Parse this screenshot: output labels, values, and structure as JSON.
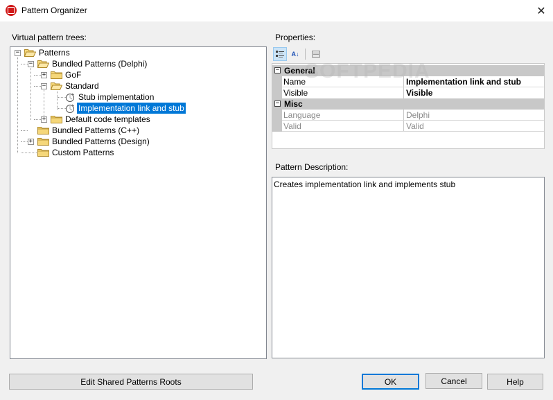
{
  "window": {
    "title": "Pattern Organizer",
    "close_glyph": "✕"
  },
  "left": {
    "label": "Virtual pattern trees:",
    "tree": {
      "root": "Patterns",
      "delphi": "Bundled Patterns (Delphi)",
      "gof": "GoF",
      "standard": "Standard",
      "stub_impl": "Stub implementation",
      "impl_link": "Implementation link and stub",
      "default_templates": "Default code templates",
      "cpp": "Bundled Patterns (C++)",
      "design": "Bundled Patterns (Design)",
      "custom": "Custom Patterns"
    },
    "selected_node": "Implementation link and stub"
  },
  "properties": {
    "label": "Properties:",
    "toolbar": {
      "categorized_icon": "categorized-icon",
      "sort_icon": "sort-az-icon",
      "pages_icon": "property-pages-icon",
      "sort_glyph": "A↓"
    },
    "categories": {
      "general": {
        "name": "General",
        "rows": {
          "name_label": "Name",
          "name_value": "Implementation link and stub",
          "visible_label": "Visible",
          "visible_value": "Visible"
        }
      },
      "misc": {
        "name": "Misc",
        "rows": {
          "language_label": "Language",
          "language_value": "Delphi",
          "valid_label": "Valid",
          "valid_value": "Valid"
        }
      }
    }
  },
  "description": {
    "label": "Pattern Description:",
    "text": "Creates implementation link and implements stub"
  },
  "buttons": {
    "edit_roots": "Edit Shared Patterns Roots",
    "ok": "OK",
    "cancel": "Cancel",
    "help": "Help"
  },
  "watermark": "SOFTPEDIA",
  "colors": {
    "selection": "#0078d7",
    "category_bg": "#c8c8c8",
    "folder": "#f5d77a"
  }
}
